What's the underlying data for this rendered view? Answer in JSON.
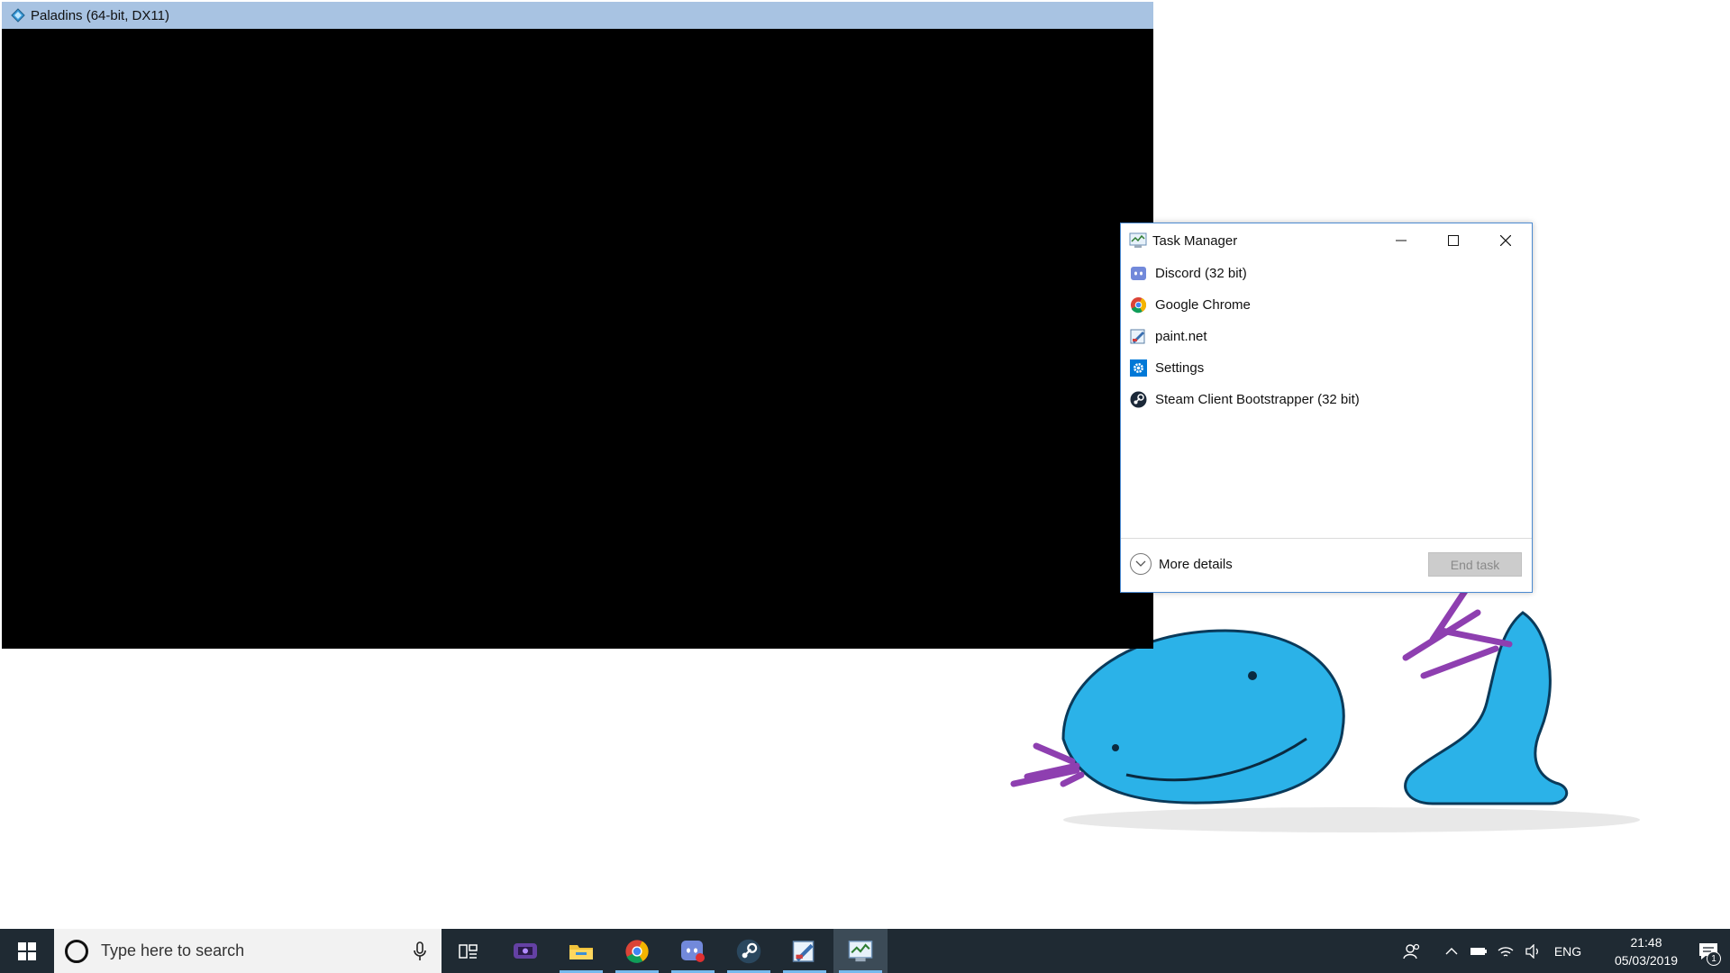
{
  "paladins_window": {
    "title": "Paladins (64-bit, DX11)"
  },
  "task_manager": {
    "title": "Task Manager",
    "items": [
      {
        "label": "Discord (32 bit)",
        "icon": "discord-icon"
      },
      {
        "label": "Google Chrome",
        "icon": "chrome-icon"
      },
      {
        "label": "paint.net",
        "icon": "paintnet-icon"
      },
      {
        "label": "Settings",
        "icon": "settings-icon"
      },
      {
        "label": "Steam Client Bootstrapper (32 bit)",
        "icon": "steam-icon"
      }
    ],
    "more_details_label": "More details",
    "end_task_label": "End task"
  },
  "taskbar": {
    "search_placeholder": "Type here to search",
    "pinned": [
      "task-view-icon",
      "twitch-icon",
      "file-explorer-icon",
      "chrome-icon",
      "discord-icon",
      "steam-icon",
      "paintnet-icon",
      "task-manager-icon"
    ],
    "tray": {
      "language": "ENG",
      "time": "21:48",
      "date": "05/03/2019",
      "notification_count": "1"
    }
  },
  "colors": {
    "taskbar": "#1f2a33",
    "accent": "#76b9ed",
    "titlebar": "#a8c3e2",
    "tm_border": "#4c8ad1"
  }
}
